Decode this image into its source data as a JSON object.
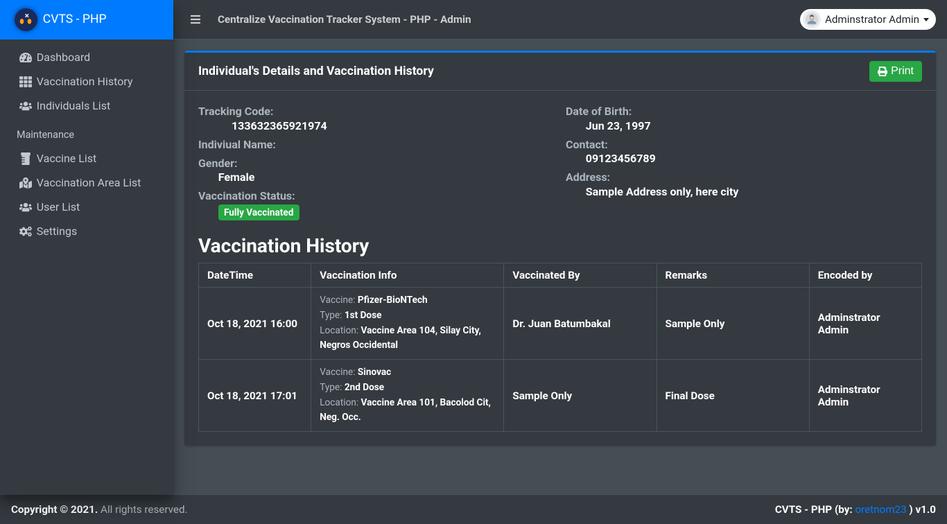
{
  "brand": "CVTS - PHP",
  "navbar": {
    "title": "Centralize Vaccination Tracker System - PHP - Admin",
    "user": "Adminstrator Admin"
  },
  "sidebar": {
    "items": [
      {
        "label": "Dashboard",
        "icon": "dashboard"
      },
      {
        "label": "Vaccination History",
        "icon": "th-list"
      },
      {
        "label": "Individuals List",
        "icon": "users"
      }
    ],
    "header": "Maintenance",
    "maint": [
      {
        "label": "Vaccine List",
        "icon": "prescription"
      },
      {
        "label": "Vaccination Area List",
        "icon": "map-marked"
      },
      {
        "label": "User List",
        "icon": "users"
      },
      {
        "label": "Settings",
        "icon": "cogs"
      }
    ]
  },
  "card": {
    "title": "Individual's Details and Vaccination History",
    "print": "Print"
  },
  "details": {
    "tracking_label": "Tracking Code:",
    "tracking_value": "133632365921974",
    "name_label": "Indiviual Name:",
    "name_value": "",
    "gender_label": "Gender:",
    "gender_value": "Female",
    "status_label": "Vaccination Status:",
    "status_value": "Fully Vaccinated",
    "dob_label": "Date of Birth:",
    "dob_value": "Jun 23, 1997",
    "contact_label": "Contact:",
    "contact_value": "09123456789",
    "address_label": "Address:",
    "address_value": "Sample Address only, here city"
  },
  "history": {
    "title": "Vaccination History",
    "headers": [
      "DateTime",
      "Vaccination Info",
      "Vaccinated By",
      "Remarks",
      "Encoded by"
    ],
    "labels": {
      "vaccine": "Vaccine:",
      "type": "Type:",
      "location": "Location:"
    },
    "rows": [
      {
        "datetime": "Oct 18, 2021 16:00",
        "vaccine": "Pfizer-BioNTech",
        "type": "1st Dose",
        "location": "Vaccine Area 104, Silay City, Negros Occidental",
        "by": "Dr. Juan Batumbakal",
        "remarks": "Sample Only",
        "encoded": "Adminstrator Admin"
      },
      {
        "datetime": "Oct 18, 2021 17:01",
        "vaccine": "Sinovac",
        "type": "2nd Dose",
        "location": "Vaccine Area 101, Bacolod Cit, Neg. Occ.",
        "by": "Sample Only",
        "remarks": "Final Dose",
        "encoded": "Adminstrator Admin"
      }
    ]
  },
  "footer": {
    "copyright_strong": "Copyright © 2021.",
    "copyright_rest": " All rights reserved.",
    "right_app": "CVTS - PHP (by: ",
    "right_author": "oretnom23",
    "right_tail": " ) v1.0"
  }
}
